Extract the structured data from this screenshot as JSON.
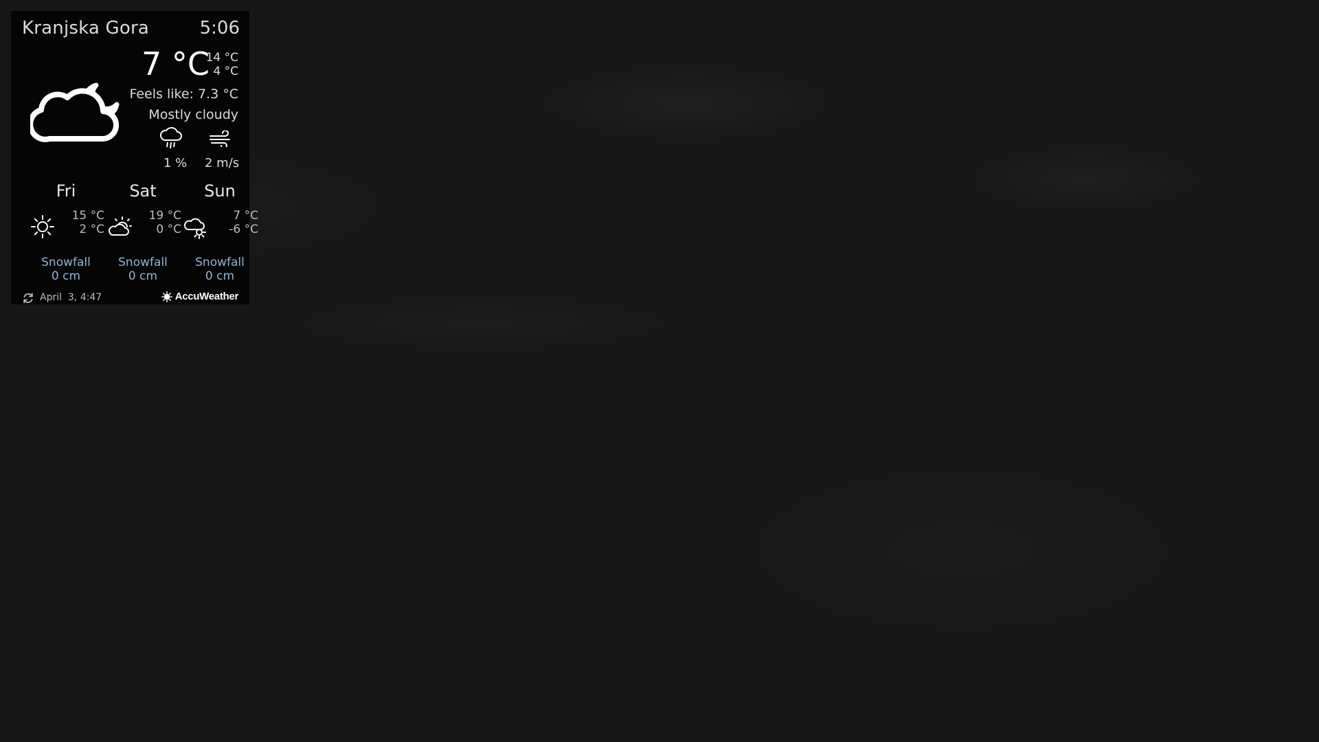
{
  "header": {
    "location": "Kranjska Gora",
    "time": "5:06"
  },
  "current": {
    "temperature": "7 °C",
    "high": "14 °C",
    "low": "4 °C",
    "feels_like": "Feels like: 7.3 °C",
    "condition": "Mostly cloudy",
    "condition_icon": "cloud-moon-icon",
    "precip_icon": "rain-cloud-icon",
    "precipitation": "1 %",
    "wind_icon": "wind-icon",
    "wind": "2 m/s"
  },
  "forecast": [
    {
      "day": "Fri",
      "high": "15 °C",
      "low": "2 °C",
      "icon": "sun-icon",
      "snow_label": "Snowfall",
      "snow_value": "0 cm"
    },
    {
      "day": "Sat",
      "high": "19 °C",
      "low": "0 °C",
      "icon": "partly-cloudy-icon",
      "snow_label": "Snowfall",
      "snow_value": "0 cm"
    },
    {
      "day": "Sun",
      "high": "7 °C",
      "low": "-6 °C",
      "icon": "cloud-sun-icon",
      "snow_label": "Snowfall",
      "snow_value": "0 cm"
    }
  ],
  "footer": {
    "updated": "April  3, 4:47",
    "refresh_icon": "refresh-icon",
    "brand": "AccuWeather"
  },
  "colors": {
    "background": "#171717",
    "panel": "#050505",
    "snow_text": "#8fb6d9"
  }
}
